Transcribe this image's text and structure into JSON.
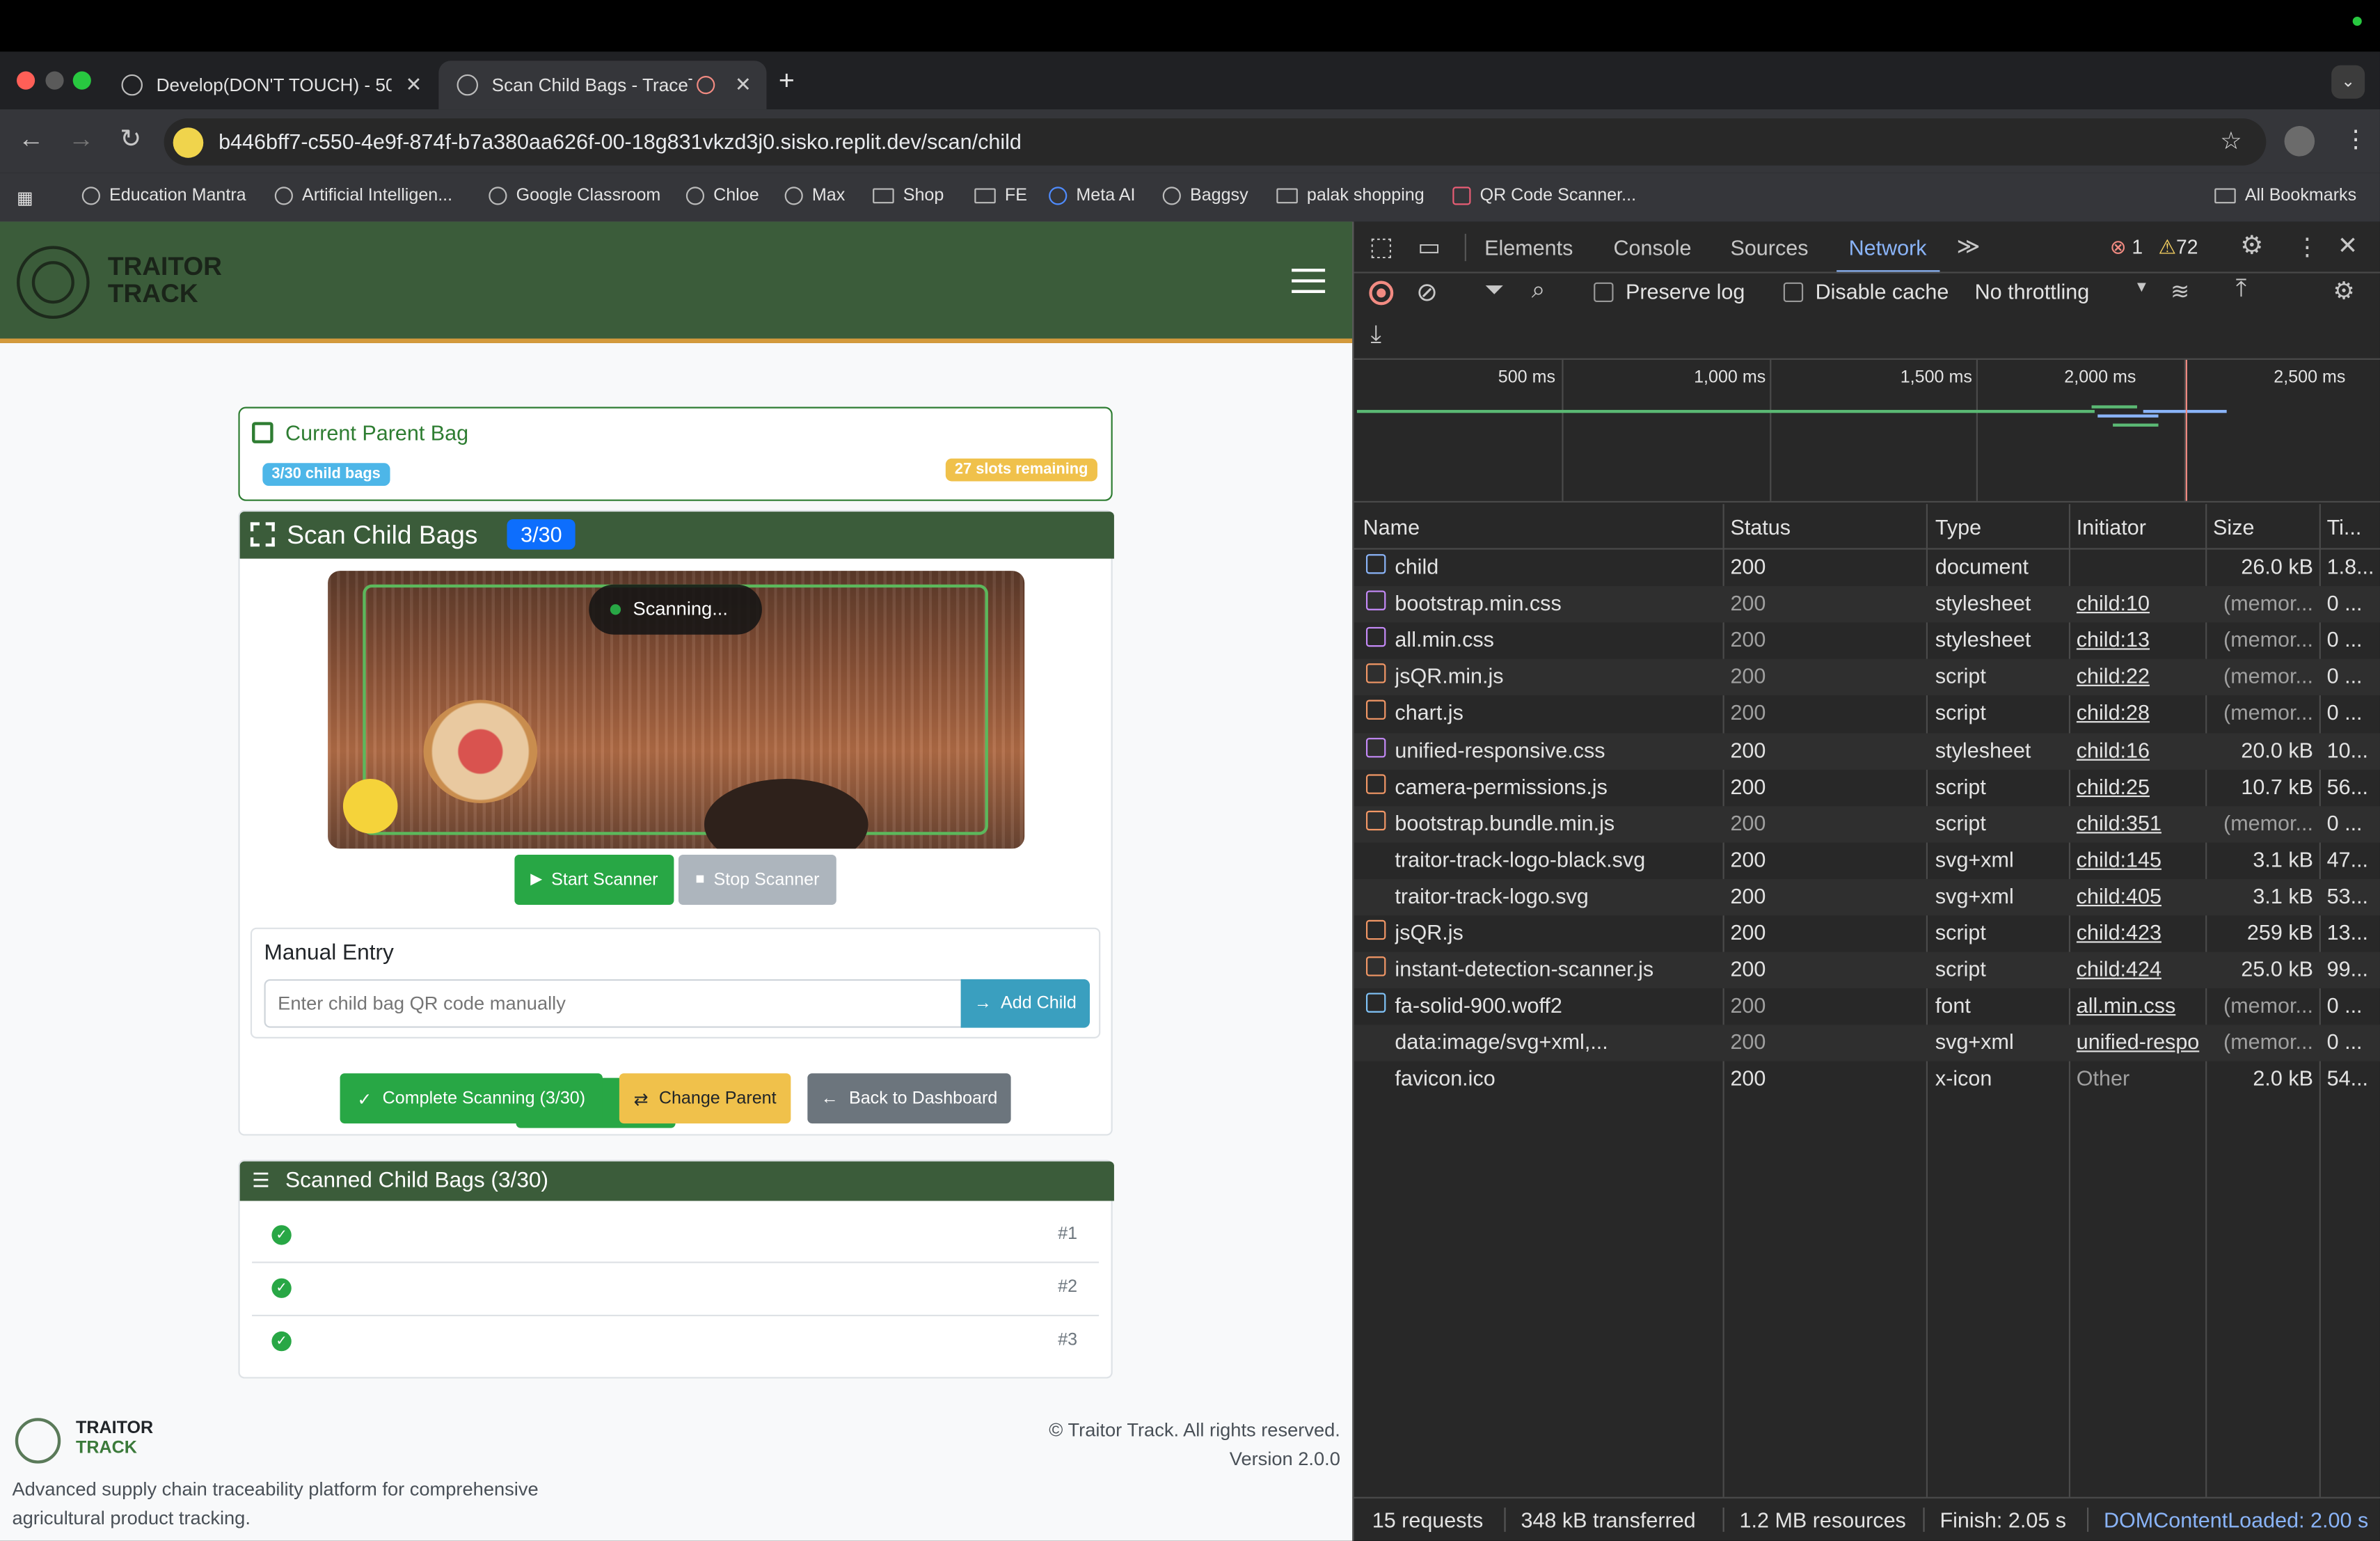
{
  "browser": {
    "tabs": [
      {
        "label": "Develop(DON'T TOUCH) - 50"
      },
      {
        "label": "Scan Child Bags - TraceTr"
      }
    ],
    "url": "b446bff7-c550-4e9f-874f-b7a380aa626f-00-18g831vkzd3j0.sisko.replit.dev/scan/child",
    "bookmarks": [
      "Education Mantra",
      "Artificial Intelligen...",
      "Google Classroom",
      "Chloe",
      "Max",
      "Shop",
      "FE",
      "Meta AI",
      "Baggsy",
      "palak shopping",
      "QR Code Scanner..."
    ],
    "all_bookmarks": "All Bookmarks"
  },
  "app": {
    "brand_line1": "TRAITOR",
    "brand_line2": "TRACK",
    "parent_card": {
      "title": "Current Parent Bag",
      "child_count_badge": "3/30 child bags",
      "slots_badge": "27 slots remaining"
    },
    "scan_card": {
      "title": "Scan Child Bags",
      "count_badge": "3/30",
      "scanning_status": "Scanning...",
      "start_button": "Start Scanner",
      "stop_button": "Stop Scanner"
    },
    "manual_entry": {
      "title": "Manual Entry",
      "placeholder": "Enter child bag QR code manually",
      "add_button": "Add Child"
    },
    "actions": {
      "complete": "Complete Scanning (3/30)",
      "change_parent": "Change Parent",
      "back": "Back to Dashboard"
    },
    "scanned_list": {
      "title": "Scanned Child Bags (3/30)",
      "items": [
        {
          "num": "#1"
        },
        {
          "num": "#2"
        },
        {
          "num": "#3"
        }
      ]
    },
    "footer": {
      "brand_line1": "TRAITOR",
      "brand_line2": "TRACK",
      "tagline_line1": "Advanced supply chain traceability platform for comprehensive",
      "tagline_line2": "agricultural product tracking.",
      "copyright": "© Traitor Track. All rights reserved.",
      "version": "Version 2.0.0"
    }
  },
  "devtools": {
    "tabs": [
      "Elements",
      "Console",
      "Sources",
      "Network"
    ],
    "errors": "1",
    "warnings": "72",
    "preserve_log": "Preserve log",
    "disable_cache": "Disable cache",
    "throttling": "No throttling",
    "timeline_ticks": [
      "500 ms",
      "1,000 ms",
      "1,500 ms",
      "2,000 ms",
      "2,500 ms"
    ],
    "columns": [
      "Name",
      "Status",
      "Type",
      "Initiator",
      "Size",
      "Ti..."
    ],
    "rows": [
      {
        "name": "child",
        "status": "200",
        "type": "document",
        "initiator": "",
        "size": "26.0 kB",
        "time": "1.8..."
      },
      {
        "name": "bootstrap.min.css",
        "status": "200",
        "type": "stylesheet",
        "initiator": "child:10",
        "size": "(memor...",
        "time": "0 ..."
      },
      {
        "name": "all.min.css",
        "status": "200",
        "type": "stylesheet",
        "initiator": "child:13",
        "size": "(memor...",
        "time": "0 ..."
      },
      {
        "name": "jsQR.min.js",
        "status": "200",
        "type": "script",
        "initiator": "child:22",
        "size": "(memor...",
        "time": "0 ..."
      },
      {
        "name": "chart.js",
        "status": "200",
        "type": "script",
        "initiator": "child:28",
        "size": "(memor...",
        "time": "0 ..."
      },
      {
        "name": "unified-responsive.css",
        "status": "200",
        "type": "stylesheet",
        "initiator": "child:16",
        "size": "20.0 kB",
        "time": "10..."
      },
      {
        "name": "camera-permissions.js",
        "status": "200",
        "type": "script",
        "initiator": "child:25",
        "size": "10.7 kB",
        "time": "56..."
      },
      {
        "name": "bootstrap.bundle.min.js",
        "status": "200",
        "type": "script",
        "initiator": "child:351",
        "size": "(memor...",
        "time": "0 ..."
      },
      {
        "name": "traitor-track-logo-black.svg",
        "status": "200",
        "type": "svg+xml",
        "initiator": "child:145",
        "size": "3.1 kB",
        "time": "47..."
      },
      {
        "name": "traitor-track-logo.svg",
        "status": "200",
        "type": "svg+xml",
        "initiator": "child:405",
        "size": "3.1 kB",
        "time": "53..."
      },
      {
        "name": "jsQR.js",
        "status": "200",
        "type": "script",
        "initiator": "child:423",
        "size": "259 kB",
        "time": "13..."
      },
      {
        "name": "instant-detection-scanner.js",
        "status": "200",
        "type": "script",
        "initiator": "child:424",
        "size": "25.0 kB",
        "time": "99..."
      },
      {
        "name": "fa-solid-900.woff2",
        "status": "200",
        "type": "font",
        "initiator": "all.min.css",
        "size": "(memor...",
        "time": "0 ..."
      },
      {
        "name": "data:image/svg+xml,...",
        "status": "200",
        "type": "svg+xml",
        "initiator": "unified-respo",
        "size": "(memor...",
        "time": "0 ..."
      },
      {
        "name": "favicon.ico",
        "status": "200",
        "type": "x-icon",
        "initiator": "Other",
        "size": "2.0 kB",
        "time": "54..."
      }
    ],
    "status_bar": {
      "requests": "15 requests",
      "transferred": "348 kB transferred",
      "resources": "1.2 MB resources",
      "finish": "Finish: 2.05 s",
      "dcl": "DOMContentLoaded: 2.00 s"
    }
  },
  "colors": {
    "header_green": "#3b5c3a",
    "accent_green": "#28a745",
    "badge_blue": "#0d6efd",
    "warning": "#f0c14b"
  }
}
